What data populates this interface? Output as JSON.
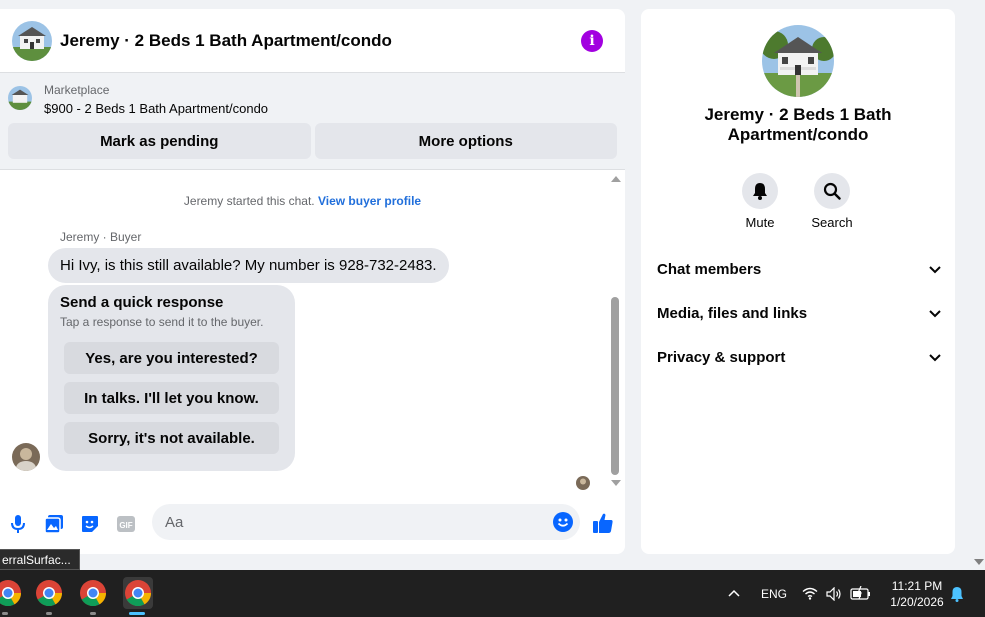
{
  "chat": {
    "title": "Jeremy · 2 Beds 1 Bath Apartment/condo",
    "info_icon": "info-icon",
    "marketplace_label": "Marketplace",
    "listing": "$900 - 2 Beds 1 Bath Apartment/condo",
    "mark_pending": "Mark as pending",
    "more_options": "More options"
  },
  "messages": {
    "system_text": "Jeremy started this chat.",
    "system_link": "View buyer profile",
    "sender": "Jeremy · Buyer",
    "first_message": "Hi Ivy, is this still available? My number is 928-732-2483.",
    "quick_title": "Send a quick response",
    "quick_subtitle": "Tap a response to send it to the buyer.",
    "quick_responses": [
      "Yes, are you interested?",
      "In talks. I'll let you know.",
      "Sorry, it's not available."
    ]
  },
  "composer": {
    "placeholder": "Aa",
    "icons": [
      "microphone-icon",
      "photo-icon",
      "sticker-icon",
      "gif-icon",
      "emoji-icon",
      "like-icon"
    ]
  },
  "info_panel": {
    "name": "Jeremy · 2 Beds 1 Bath Apartment/condo",
    "mute_label": "Mute",
    "search_label": "Search",
    "sections": [
      "Chat members",
      "Media, files and links",
      "Privacy & support"
    ]
  },
  "taskbar": {
    "tooltip": "erralSurfac...",
    "language": "ENG",
    "time": "11:21 PM",
    "date": "1/20/2026"
  },
  "colors": {
    "accent": "#0866ff",
    "info": "#a200e0",
    "link": "#216fdb"
  }
}
